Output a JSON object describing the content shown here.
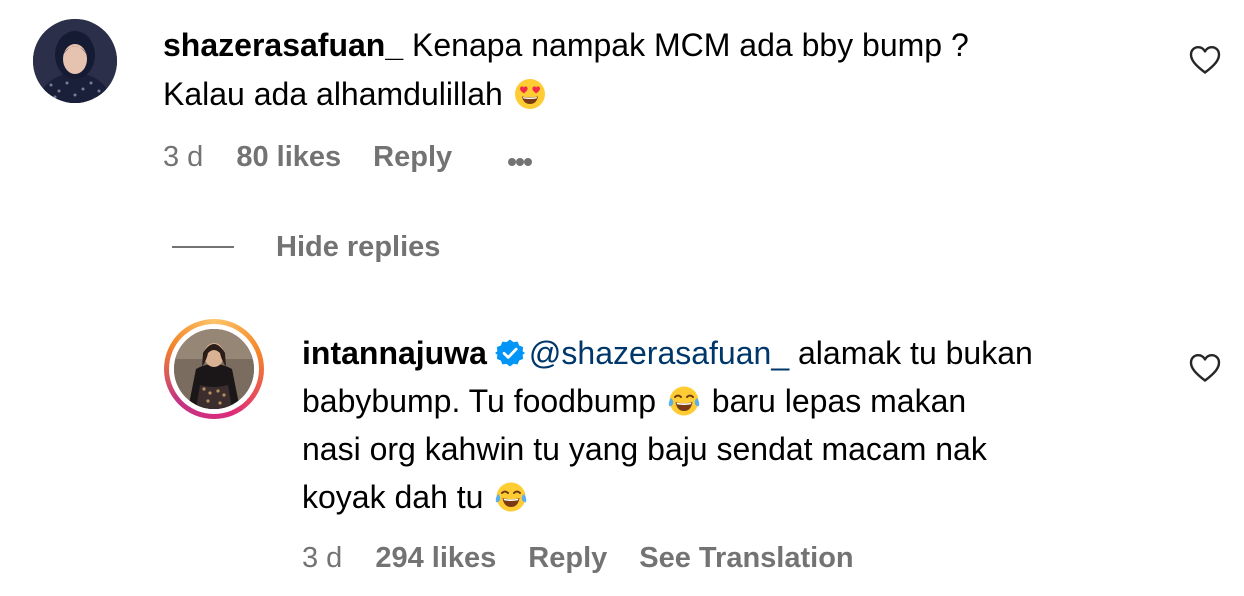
{
  "comment": {
    "username": "shazerasafuan_",
    "text_line1": "Kenapa nampak MCM ada bby bump ?",
    "text_line2": "Kalau ada alhamdulillah",
    "emoji": "heart-eyes-emoji",
    "time": "3 d",
    "likes": "80 likes",
    "reply_label": "Reply",
    "more_icon": "more-dots-icon",
    "like_icon": "heart-outline-icon"
  },
  "hide_replies_label": "Hide replies",
  "reply": {
    "username": "intannajuwa",
    "verified_icon": "verified-badge-icon",
    "mention": "@shazerasafuan_",
    "text_part1": " alamak tu bukan",
    "text_line2a": "babybump. Tu foodbump",
    "text_line2b": " baru lepas makan",
    "text_line3": "nasi org kahwin tu yang baju sendat macam nak",
    "text_line4": "koyak dah tu",
    "emoji": "tears-of-joy-emoji",
    "time": "3 d",
    "likes": "294 likes",
    "reply_label": "Reply",
    "translation_label": "See Translation",
    "like_icon": "heart-outline-icon"
  },
  "colors": {
    "text": "#000000",
    "secondary": "#737373",
    "mention": "#00376b",
    "verified": "#0095f6"
  }
}
